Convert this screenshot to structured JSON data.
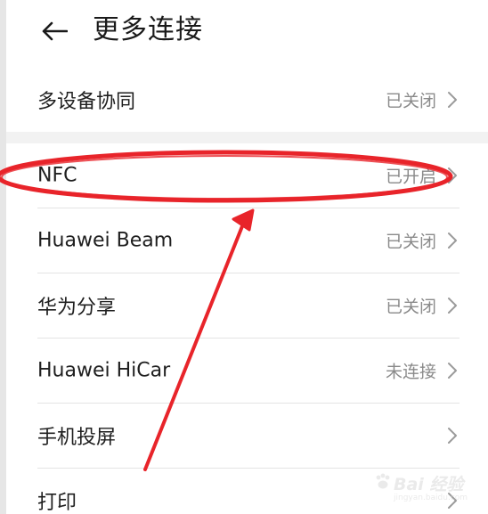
{
  "header": {
    "title": "更多连接"
  },
  "rows": [
    {
      "label": "多设备协同",
      "value": "已关闭"
    },
    {
      "label": "NFC",
      "value": "已开启"
    },
    {
      "label": "Huawei Beam",
      "value": "已关闭"
    },
    {
      "label": "华为分享",
      "value": "已关闭"
    },
    {
      "label": "Huawei HiCar",
      "value": "未连接"
    },
    {
      "label": "手机投屏",
      "value": ""
    },
    {
      "label": "打印",
      "value": ""
    }
  ],
  "annotation": {
    "color": "#e8242a"
  },
  "watermark": {
    "brand": "Bai 经验",
    "url": "jingyan.baidu.com"
  },
  "colors": {
    "text": "#1f1f1f",
    "secondary": "#8a8a8a",
    "divider": "#e3e3e3"
  }
}
